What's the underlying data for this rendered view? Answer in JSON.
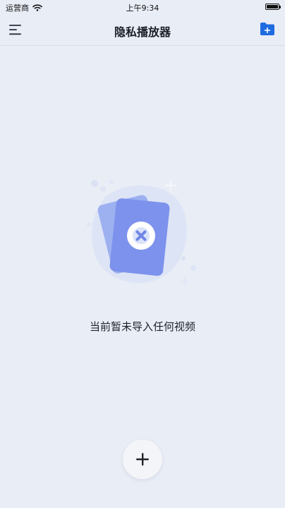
{
  "status_bar": {
    "carrier": "运营商",
    "time": "上午9:34"
  },
  "nav": {
    "title": "隐私播放器",
    "left_icon": "menu-icon",
    "right_icon": "add-folder-icon"
  },
  "empty_state": {
    "message": "当前暂未导入任何视频",
    "icon": "empty-video-illustration"
  },
  "fab": {
    "icon": "plus-icon"
  },
  "colors": {
    "background": "#e9edf6",
    "accent": "#1f6be0",
    "card": "#7c92ec"
  }
}
